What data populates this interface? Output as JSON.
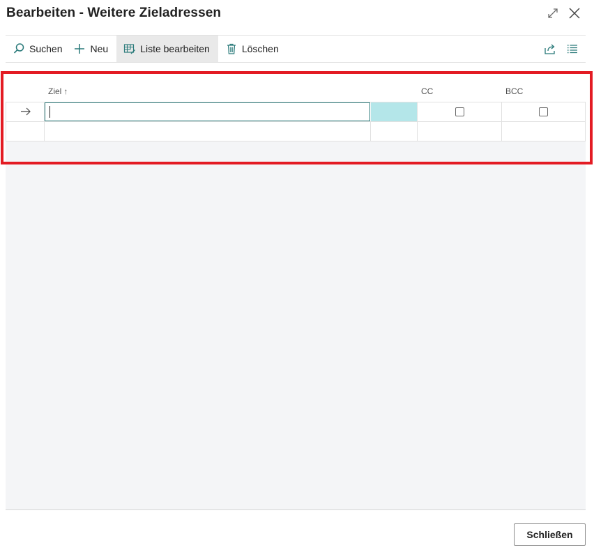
{
  "dialog": {
    "title": "Bearbeiten - Weitere Zieladressen",
    "expand_icon": "expand-icon",
    "close_icon": "close-icon"
  },
  "actions": {
    "search_label": "Suchen",
    "new_label": "Neu",
    "edit_list_label": "Liste bearbeiten",
    "delete_label": "Löschen",
    "share_icon": "share-icon",
    "list_view_icon": "list-view-icon"
  },
  "grid": {
    "columns": {
      "ziel": "Ziel",
      "cc": "CC",
      "bcc": "BCC"
    },
    "sort_indicator": "↑",
    "rows": [
      {
        "ziel": "",
        "cc": false,
        "bcc": false,
        "current": true
      },
      {
        "ziel": "",
        "cc": null,
        "bcc": null,
        "current": false
      }
    ]
  },
  "footer": {
    "close_button_label": "Schließen"
  },
  "colors": {
    "accent": "#2a7a7a",
    "selection_fill": "#b4e6e9",
    "highlight_frame": "#e31b23"
  }
}
